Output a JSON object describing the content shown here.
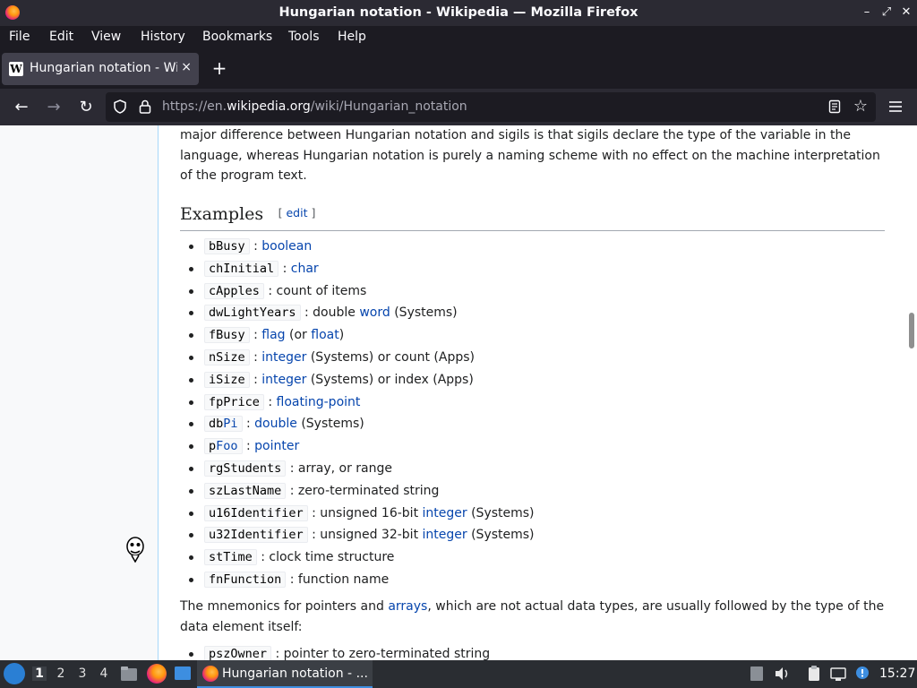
{
  "window": {
    "title": "Hungarian notation - Wikipedia — Mozilla Firefox",
    "controls": {
      "minimize": "–",
      "maximize": "⤢",
      "close": "✕"
    }
  },
  "menu": [
    "File",
    "Edit",
    "View",
    "History",
    "Bookmarks",
    "Tools",
    "Help"
  ],
  "tab": {
    "title": "Hungarian notation - Wik",
    "favicon": "W",
    "close": "×",
    "new_tab": "+"
  },
  "nav": {
    "back": "←",
    "forward": "→",
    "reload": "↻",
    "url_prefix": "https://en.",
    "url_host": "wikipedia.org",
    "url_path": "/wiki/Hungarian_notation",
    "star": "☆"
  },
  "article": {
    "intro": "major difference between Hungarian notation and sigils is that sigils declare the type of the variable in the language, whereas Hungarian notation is purely a naming scheme with no effect on the machine interpretation of the program text.",
    "section_title": "Examples",
    "edit_open": "[ ",
    "edit_label": "edit",
    "edit_close": " ]",
    "examples": [
      {
        "code": "bBusy",
        "parts": [
          [
            " : ",
            false
          ],
          [
            "boolean",
            true
          ]
        ]
      },
      {
        "code": "chInitial",
        "parts": [
          [
            " : ",
            false
          ],
          [
            "char",
            true
          ]
        ]
      },
      {
        "code": "cApples",
        "parts": [
          [
            " : count of items",
            false
          ]
        ]
      },
      {
        "code": "dwLightYears",
        "parts": [
          [
            " : double ",
            false
          ],
          [
            "word",
            true
          ],
          [
            " (Systems)",
            false
          ]
        ]
      },
      {
        "code": "fBusy",
        "parts": [
          [
            " : ",
            false
          ],
          [
            "flag",
            true
          ],
          [
            " (or ",
            false
          ],
          [
            "float",
            true
          ],
          [
            ")",
            false
          ]
        ]
      },
      {
        "code": "nSize",
        "parts": [
          [
            " : ",
            false
          ],
          [
            "integer",
            true
          ],
          [
            " (Systems) or count (Apps)",
            false
          ]
        ]
      },
      {
        "code": "iSize",
        "parts": [
          [
            " : ",
            false
          ],
          [
            "integer",
            true
          ],
          [
            " (Systems) or index (Apps)",
            false
          ]
        ]
      },
      {
        "code": "fpPrice",
        "parts": [
          [
            " : ",
            false
          ],
          [
            "floating-point",
            true
          ]
        ]
      },
      {
        "code_parts": [
          [
            "db",
            false
          ],
          [
            "Pi",
            true
          ]
        ],
        "parts": [
          [
            " : ",
            false
          ],
          [
            "double",
            true
          ],
          [
            " (Systems)",
            false
          ]
        ]
      },
      {
        "code_parts": [
          [
            "p",
            false
          ],
          [
            "Foo",
            true
          ]
        ],
        "parts": [
          [
            " : ",
            false
          ],
          [
            "pointer",
            true
          ]
        ]
      },
      {
        "code": "rgStudents",
        "parts": [
          [
            " : array, or range",
            false
          ]
        ]
      },
      {
        "code": "szLastName",
        "parts": [
          [
            " : zero-terminated string",
            false
          ]
        ]
      },
      {
        "code": "u16Identifier",
        "parts": [
          [
            " : unsigned 16-bit ",
            false
          ],
          [
            "integer",
            true
          ],
          [
            " (Systems)",
            false
          ]
        ]
      },
      {
        "code": "u32Identifier",
        "parts": [
          [
            " : unsigned 32-bit ",
            false
          ],
          [
            "integer",
            true
          ],
          [
            " (Systems)",
            false
          ]
        ]
      },
      {
        "code": "stTime",
        "parts": [
          [
            " : clock time structure",
            false
          ]
        ]
      },
      {
        "code": "fnFunction",
        "parts": [
          [
            " : function name",
            false
          ]
        ]
      }
    ],
    "para2_a": "The mnemonics for pointers and ",
    "para2_link": "arrays",
    "para2_b": ", which are not actual data types, are usually followed by the type of the data element itself:",
    "examples2": [
      {
        "code": "pszOwner",
        "text": " : pointer to zero-terminated string"
      }
    ]
  },
  "taskbar": {
    "workspaces": [
      "1",
      "2",
      "3",
      "4"
    ],
    "active_workspace": "1",
    "task_title": "Hungarian notation - ...",
    "clock": "15:27"
  }
}
